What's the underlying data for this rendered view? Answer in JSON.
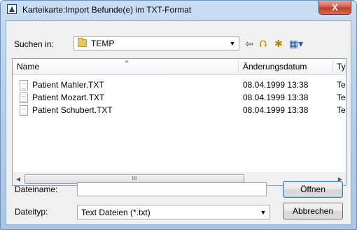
{
  "window": {
    "title": "Karteikarte:Import Befunde(e) im TXT-Format",
    "close_label": "X"
  },
  "toolbar": {
    "look_in_label": "Suchen in:",
    "look_in_value": "TEMP",
    "back_icon": "back-arrow-icon",
    "up_icon": "up-folder-icon",
    "new_folder_icon": "new-folder-icon",
    "view_icon": "view-menu-icon"
  },
  "file_list": {
    "columns": [
      "Name",
      "Änderungsdatum",
      "Ty"
    ],
    "rows": [
      {
        "name": "Patient Mahler.TXT",
        "date": "08.04.1999 13:38",
        "type": "Te"
      },
      {
        "name": "Patient Mozart.TXT",
        "date": "08.04.1999 13:38",
        "type": "Te"
      },
      {
        "name": "Patient Schubert.TXT",
        "date": "08.04.1999 13:38",
        "type": "Te"
      }
    ],
    "scrollbar_grip": "III"
  },
  "filename": {
    "label": "Dateiname:",
    "value": ""
  },
  "filetype": {
    "label": "Dateityp:",
    "value": "Text Dateien (*.txt)"
  },
  "buttons": {
    "open": "Öffnen",
    "cancel": "Abbrechen"
  },
  "colors": {
    "title_bar": "#b7d1ec",
    "close_button": "#c2402a",
    "dialog_bg": "#f0f0f0"
  }
}
